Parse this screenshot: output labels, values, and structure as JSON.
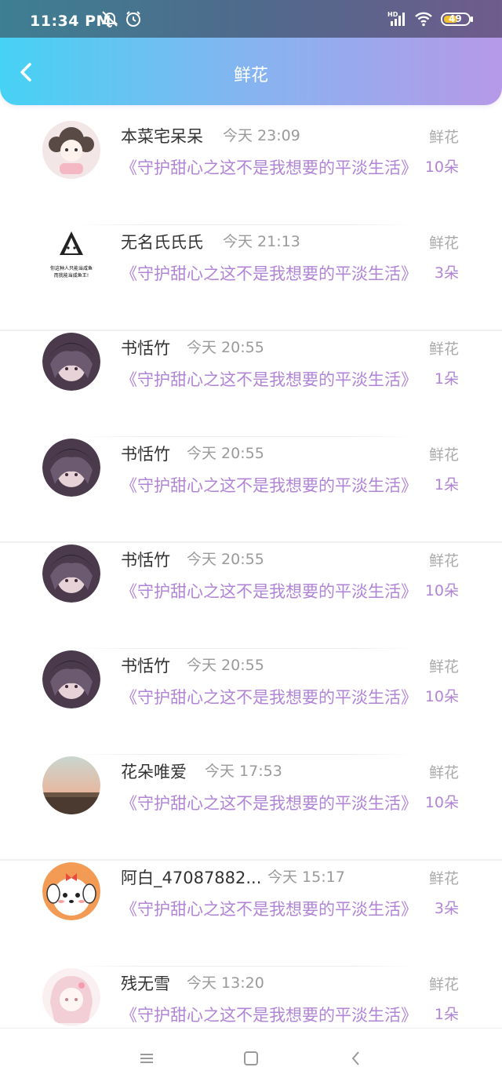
{
  "status": {
    "time": "11:34 PM",
    "battery": "49"
  },
  "header": {
    "title": "鲜花"
  },
  "gift_label": "鲜花",
  "rows": [
    {
      "name": "本菜宅呆呆",
      "time": "今天 23:09",
      "book": "《守护甜心之这不是我想要的平淡生活》",
      "count": "10朵",
      "avatar": "cartoon-girl"
    },
    {
      "name": "无名氏氏氏",
      "time": "今天 21:13",
      "book": "《守护甜心之这不是我想要的平淡生活》",
      "count": "3朵",
      "avatar": "meme-sticker",
      "avatar_text": [
        "你这种人只能当咸鱼",
        "而我能当咸鱼王!"
      ]
    },
    {
      "name": "书恬竹",
      "time": "今天 20:55",
      "book": "《守护甜心之这不是我想要的平淡生活》",
      "count": "1朵",
      "avatar": "anime-girl-dark"
    },
    {
      "name": "书恬竹",
      "time": "今天 20:55",
      "book": "《守护甜心之这不是我想要的平淡生活》",
      "count": "1朵",
      "avatar": "anime-girl-dark"
    },
    {
      "name": "书恬竹",
      "time": "今天 20:55",
      "book": "《守护甜心之这不是我想要的平淡生活》",
      "count": "10朵",
      "avatar": "anime-girl-dark"
    },
    {
      "name": "书恬竹",
      "time": "今天 20:55",
      "book": "《守护甜心之这不是我想要的平淡生活》",
      "count": "10朵",
      "avatar": "anime-girl-dark"
    },
    {
      "name": "花朵唯爱",
      "time": "今天 17:53",
      "book": "《守护甜心之这不是我想要的平淡生活》",
      "count": "10朵",
      "avatar": "window-sunset"
    },
    {
      "name": "阿白_47087882...",
      "time": "今天 15:17",
      "book": "《守护甜心之这不是我想要的平淡生活》",
      "count": "3朵",
      "avatar": "puppy-cartoon"
    },
    {
      "name": "残无雪",
      "time": "今天 13:20",
      "book": "《守护甜心之这不是我想要的平淡生活》",
      "count": "1朵",
      "avatar": "pink-hair-girl"
    }
  ],
  "nav": {
    "items": [
      "menu-icon",
      "home-icon",
      "back-icon"
    ]
  }
}
